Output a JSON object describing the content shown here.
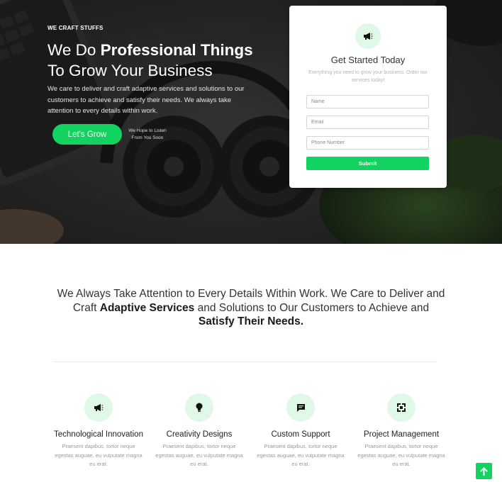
{
  "hero": {
    "eyebrow": "WE CRAFT STUFFS",
    "headline_line1_plain": "We Do ",
    "headline_line1_bold": "Professional Things",
    "headline_line2": "To Grow Your Business",
    "description": "We care to deliver and craft adaptive services and solutions to our customers to achieve and satisfy their needs. We always take attention to every details within work.",
    "cta_label": "Let's Grow",
    "cta_note": "We Hope to Listen From You Soon"
  },
  "form": {
    "icon": "megaphone-icon",
    "title": "Get Started Today",
    "subtitle": "Everything you need to grow your business. Order our services today!",
    "name_placeholder": "Name",
    "email_placeholder": "Email",
    "phone_placeholder": "Phone Number",
    "submit_label": "Submit"
  },
  "statement": {
    "part1": "We Always Take Attention to Every Details Within Work. We Care to Deliver and Craft ",
    "bold1": "Adaptive Services",
    "part2": " and Solutions to Our Customers to Achieve and ",
    "bold2": "Satisfy Their Needs."
  },
  "features": [
    {
      "icon": "megaphone-icon",
      "title": "Technological Innovation",
      "text": "Praesent dapibus, tortor neque egestas auguae, eu vulputate magna eu erat."
    },
    {
      "icon": "lightbulb-icon",
      "title": "Creativity Designs",
      "text": "Praesent dapibus, tortor neque egestas auguae, eu vulputate magna eu erat."
    },
    {
      "icon": "chat-icon",
      "title": "Custom Support",
      "text": "Praesent dapibus, tortor neque egestas auguae, eu vulputate magna eu erat."
    },
    {
      "icon": "fullscreen-icon",
      "title": "Project Management",
      "text": "Praesent dapibus, tortor neque egestas auguae, eu vulputate magna eu erat."
    }
  ],
  "scroll_top_icon": "arrow-up-icon",
  "colors": {
    "accent": "#12d35f",
    "icon_bg": "#dff8e8",
    "icon_fg": "#111111"
  }
}
